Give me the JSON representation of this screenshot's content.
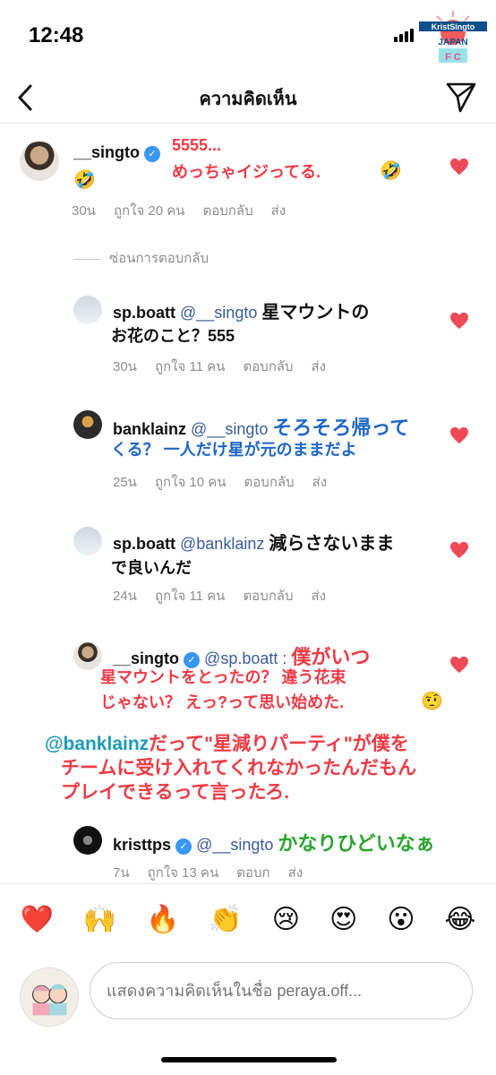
{
  "status": {
    "time": "12:48"
  },
  "logo": {
    "line1": "KristSingto",
    "line2": "JAPAN",
    "line3": "F C"
  },
  "header": {
    "title": "ความคิดเห็น"
  },
  "main_comment": {
    "username": "__singto",
    "text_line1": "5555...",
    "text_line2": "めっちゃイジってる.",
    "emoji": "🤣",
    "time": "30น",
    "likes": "ถูกใจ 20 คน",
    "reply": "ตอบกลับ",
    "send": "ส่ง"
  },
  "hide_replies": "ซ่อนการตอบกลับ",
  "replies": [
    {
      "username": "sp.boatt",
      "mention": "@__singto",
      "text_line1": "星マウントの",
      "text_line2": "お花のこと？555",
      "time": "30น",
      "likes": "ถูกใจ 11 คน",
      "reply": "ตอบกลับ",
      "send": "ส่ง"
    },
    {
      "username": "banklainz",
      "mention": "@__singto",
      "text_line1": "そろそろ帰って",
      "text_line2": "くる？ 一人だけ星が元のままだよ",
      "time": "25น",
      "likes": "ถูกใจ 10 คน",
      "reply": "ตอบกลับ",
      "send": "ส่ง"
    },
    {
      "username": "sp.boatt",
      "mention": "@banklainz",
      "text_line1": "減らさないまま",
      "text_line2": "で良いんだ",
      "time": "24น",
      "likes": "ถูกใจ 11 คน",
      "reply": "ตอบกลับ",
      "send": "ส่ง"
    },
    {
      "username": "__singto",
      "mention": "@sp.boatt :",
      "text_line1": "僕がいつ",
      "text_line2": "星マウントをとったの？ 違う花束",
      "text_line3": "じゃない？ えっ?って思い始めた.",
      "emoji": "🤨"
    },
    {
      "username": "kristtps",
      "mention": "@__singto",
      "text_line1": "かなりひどいなぁ",
      "time": "7น",
      "likes": "ถูกใจ 13 คน",
      "reply": "ตอบก",
      "send": "ส่ง"
    }
  ],
  "overlay": {
    "mention": "@banklainz",
    "line1": "だって\"星減りパーティ\"が僕を",
    "line2": "チームに受け入れてくれなかったんだもん",
    "line3": "プレイできるって言ったろ."
  },
  "reactions": [
    "❤️",
    "🙌",
    "🔥",
    "👏",
    "😢",
    "😍",
    "😮",
    "😂"
  ],
  "input": {
    "placeholder": "แสดงความคิดเห็นในชื่อ peraya.off..."
  },
  "colors": {
    "heart": "#ed4956",
    "red_text": "#ee3a45",
    "blue_text": "#1e66c8",
    "green_text": "#2aa52e",
    "mention": "#3b5b9e"
  }
}
